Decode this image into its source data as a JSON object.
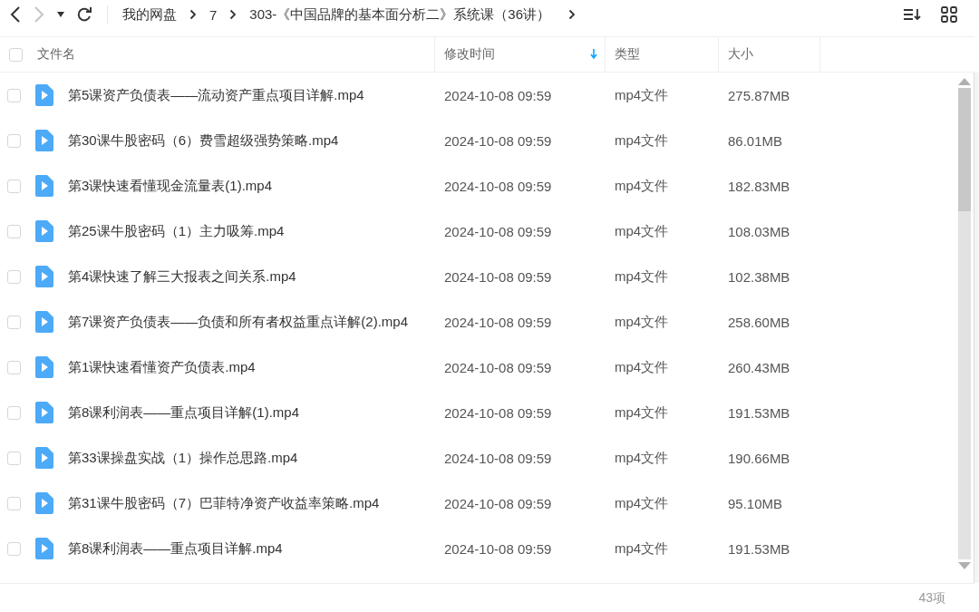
{
  "breadcrumb": [
    "我的网盘",
    "7",
    "303-《中国品牌的基本面分析二》系统课（36讲）"
  ],
  "columns": [
    {
      "label": "文件名",
      "sorted": false
    },
    {
      "label": "修改时间",
      "sorted": true
    },
    {
      "label": "类型",
      "sorted": false
    },
    {
      "label": "大小",
      "sorted": false
    }
  ],
  "select_all": {
    "checked": false
  },
  "rows": [
    {
      "name": "第5课资产负债表——流动资产重点项目详解.mp4",
      "modified": "2024-10-08 09:59",
      "type": "mp4文件",
      "size": "275.87MB",
      "checked": false
    },
    {
      "name": "第30课牛股密码（6）费雪超级强势策略.mp4",
      "modified": "2024-10-08 09:59",
      "type": "mp4文件",
      "size": "86.01MB",
      "checked": false
    },
    {
      "name": "第3课快速看懂现金流量表(1).mp4",
      "modified": "2024-10-08 09:59",
      "type": "mp4文件",
      "size": "182.83MB",
      "checked": false
    },
    {
      "name": "第25课牛股密码（1）主力吸筹.mp4",
      "modified": "2024-10-08 09:59",
      "type": "mp4文件",
      "size": "108.03MB",
      "checked": false
    },
    {
      "name": "第4课快速了解三大报表之间关系.mp4",
      "modified": "2024-10-08 09:59",
      "type": "mp4文件",
      "size": "102.38MB",
      "checked": false
    },
    {
      "name": "第7课资产负债表——负债和所有者权益重点详解(2).mp4",
      "modified": "2024-10-08 09:59",
      "type": "mp4文件",
      "size": "258.60MB",
      "checked": false
    },
    {
      "name": "第1课快速看懂资产负债表.mp4",
      "modified": "2024-10-08 09:59",
      "type": "mp4文件",
      "size": "260.43MB",
      "checked": false
    },
    {
      "name": "第8课利润表——重点项目详解(1).mp4",
      "modified": "2024-10-08 09:59",
      "type": "mp4文件",
      "size": "191.53MB",
      "checked": false
    },
    {
      "name": "第33课操盘实战（1）操作总思路.mp4",
      "modified": "2024-10-08 09:59",
      "type": "mp4文件",
      "size": "190.66MB",
      "checked": false
    },
    {
      "name": "第31课牛股密码（7）巴菲特净资产收益率策略.mp4",
      "modified": "2024-10-08 09:59",
      "type": "mp4文件",
      "size": "95.10MB",
      "checked": false
    },
    {
      "name": "第8课利润表——重点项目详解.mp4",
      "modified": "2024-10-08 09:59",
      "type": "mp4文件",
      "size": "191.53MB",
      "checked": false
    }
  ],
  "status_bar": {
    "count": "43项"
  }
}
